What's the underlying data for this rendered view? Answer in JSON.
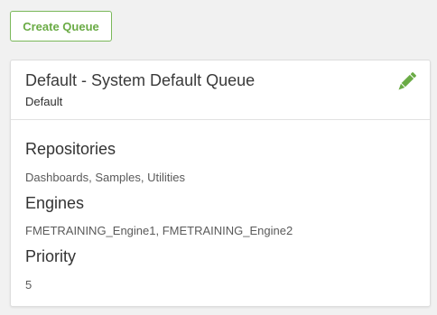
{
  "toolbar": {
    "create_queue_label": "Create Queue"
  },
  "queue": {
    "title": "Default - System Default Queue",
    "subtitle": "Default",
    "edit_icon": "pencil-icon",
    "sections": {
      "repositories": {
        "heading": "Repositories",
        "value": "Dashboards, Samples, Utilities"
      },
      "engines": {
        "heading": "Engines",
        "value": "FMETRAINING_Engine1, FMETRAINING_Engine2"
      },
      "priority": {
        "heading": "Priority",
        "value": "5"
      }
    }
  },
  "colors": {
    "accent_green": "#6aab45",
    "page_background": "#f1f1f1",
    "card_background": "#ffffff"
  }
}
